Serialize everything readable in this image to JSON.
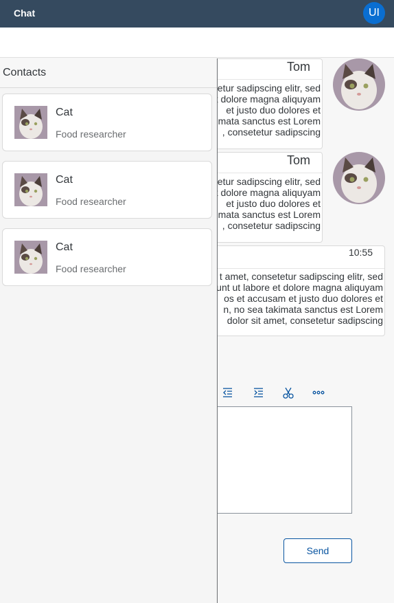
{
  "shell": {
    "title": "Chat",
    "user_initials": "UI"
  },
  "contacts": {
    "title": "Contacts",
    "items": [
      {
        "name": "Cat",
        "role": "Food researcher"
      },
      {
        "name": "Cat",
        "role": "Food researcher"
      },
      {
        "name": "Cat",
        "role": "Food researcher"
      }
    ]
  },
  "messages": [
    {
      "author": "Tom",
      "lines": [
        "etur sadipscing elitr, sed",
        "t dolore magna aliquyam",
        "et justo duo dolores et",
        "mata sanctus est Lorem",
        ", consetetur sadipscing"
      ]
    },
    {
      "author": "Tom",
      "lines": [
        "etur sadipscing elitr, sed",
        "t dolore magna aliquyam",
        "et justo duo dolores et",
        "mata sanctus est Lorem",
        ", consetetur sadipscing"
      ]
    },
    {
      "time": "10:55",
      "lines": [
        "t amet, consetetur sadipscing elitr, sed",
        "unt ut labore et dolore magna aliquyam",
        "os et accusam et justo duo dolores et",
        "n, no sea takimata sanctus est Lorem",
        "dolor sit amet, consetetur sadipscing"
      ]
    }
  ],
  "toolbar": {
    "icons": [
      "outdent-icon",
      "indent-icon",
      "cut-icon",
      "more-icon"
    ]
  },
  "composer": {
    "send_label": "Send"
  },
  "colors": {
    "shell": "#354a5f",
    "accent": "#0a6ed1",
    "link": "#0854a0"
  }
}
